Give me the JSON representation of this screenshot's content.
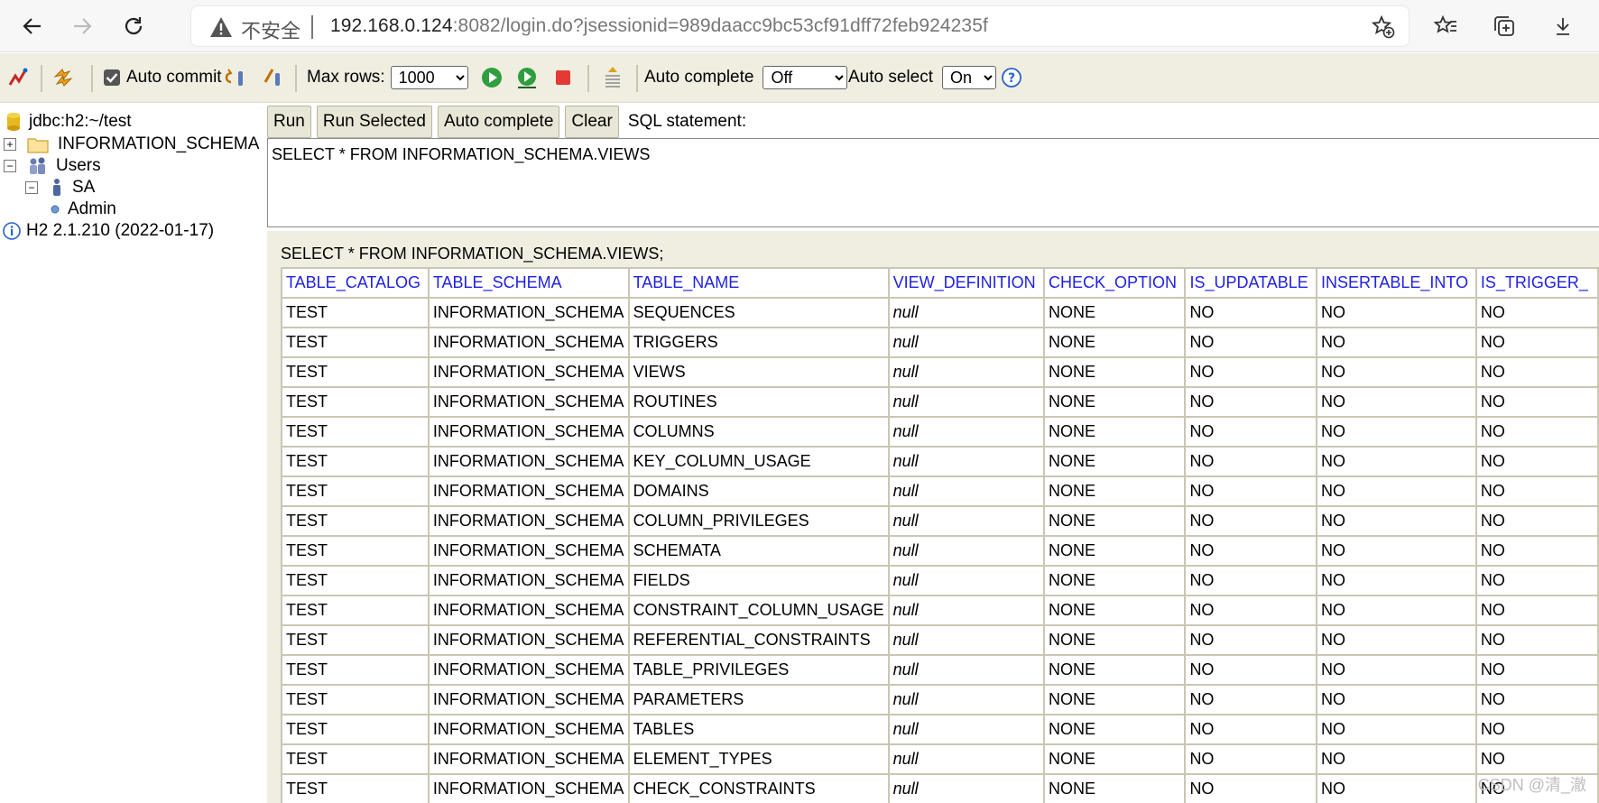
{
  "browser": {
    "security_label": "不安全",
    "url_host": "192.168.0.124",
    "url_rest": ":8082/login.do?jsessionid=989daacc9bc53cf91dff72feb924235f"
  },
  "toolbar": {
    "auto_commit_label": "Auto commit",
    "auto_commit_checked": true,
    "max_rows_label": "Max rows:",
    "max_rows_value": "1000",
    "auto_complete_label": "Auto complete",
    "auto_complete_value": "Off",
    "auto_select_label": "Auto select",
    "auto_select_value": "On",
    "help_glyph": "?"
  },
  "tree": {
    "connection": "jdbc:h2:~/test",
    "schema": "INFORMATION_SCHEMA",
    "users": "Users",
    "user": "SA",
    "role": "Admin",
    "version": "H2 2.1.210 (2022-01-17)",
    "expand_glyph": "+",
    "collapse_glyph": "−"
  },
  "query": {
    "buttons": [
      "Run",
      "Run Selected",
      "Auto complete",
      "Clear"
    ],
    "sql_label": "SQL statement:",
    "sql_text": "SELECT * FROM INFORMATION_SCHEMA.VIEWS"
  },
  "results": {
    "statement": "SELECT * FROM INFORMATION_SCHEMA.VIEWS;",
    "columns": [
      "TABLE_CATALOG",
      "TABLE_SCHEMA",
      "TABLE_NAME",
      "VIEW_DEFINITION",
      "CHECK_OPTION",
      "IS_UPDATABLE",
      "INSERTABLE_INTO",
      "IS_TRIGGER_"
    ],
    "rows": [
      [
        "TEST",
        "INFORMATION_SCHEMA",
        "SEQUENCES",
        "null",
        "NONE",
        "NO",
        "NO",
        "NO"
      ],
      [
        "TEST",
        "INFORMATION_SCHEMA",
        "TRIGGERS",
        "null",
        "NONE",
        "NO",
        "NO",
        "NO"
      ],
      [
        "TEST",
        "INFORMATION_SCHEMA",
        "VIEWS",
        "null",
        "NONE",
        "NO",
        "NO",
        "NO"
      ],
      [
        "TEST",
        "INFORMATION_SCHEMA",
        "ROUTINES",
        "null",
        "NONE",
        "NO",
        "NO",
        "NO"
      ],
      [
        "TEST",
        "INFORMATION_SCHEMA",
        "COLUMNS",
        "null",
        "NONE",
        "NO",
        "NO",
        "NO"
      ],
      [
        "TEST",
        "INFORMATION_SCHEMA",
        "KEY_COLUMN_USAGE",
        "null",
        "NONE",
        "NO",
        "NO",
        "NO"
      ],
      [
        "TEST",
        "INFORMATION_SCHEMA",
        "DOMAINS",
        "null",
        "NONE",
        "NO",
        "NO",
        "NO"
      ],
      [
        "TEST",
        "INFORMATION_SCHEMA",
        "COLUMN_PRIVILEGES",
        "null",
        "NONE",
        "NO",
        "NO",
        "NO"
      ],
      [
        "TEST",
        "INFORMATION_SCHEMA",
        "SCHEMATA",
        "null",
        "NONE",
        "NO",
        "NO",
        "NO"
      ],
      [
        "TEST",
        "INFORMATION_SCHEMA",
        "FIELDS",
        "null",
        "NONE",
        "NO",
        "NO",
        "NO"
      ],
      [
        "TEST",
        "INFORMATION_SCHEMA",
        "CONSTRAINT_COLUMN_USAGE",
        "null",
        "NONE",
        "NO",
        "NO",
        "NO"
      ],
      [
        "TEST",
        "INFORMATION_SCHEMA",
        "REFERENTIAL_CONSTRAINTS",
        "null",
        "NONE",
        "NO",
        "NO",
        "NO"
      ],
      [
        "TEST",
        "INFORMATION_SCHEMA",
        "TABLE_PRIVILEGES",
        "null",
        "NONE",
        "NO",
        "NO",
        "NO"
      ],
      [
        "TEST",
        "INFORMATION_SCHEMA",
        "PARAMETERS",
        "null",
        "NONE",
        "NO",
        "NO",
        "NO"
      ],
      [
        "TEST",
        "INFORMATION_SCHEMA",
        "TABLES",
        "null",
        "NONE",
        "NO",
        "NO",
        "NO"
      ],
      [
        "TEST",
        "INFORMATION_SCHEMA",
        "ELEMENT_TYPES",
        "null",
        "NONE",
        "NO",
        "NO",
        "NO"
      ],
      [
        "TEST",
        "INFORMATION_SCHEMA",
        "CHECK_CONSTRAINTS",
        "null",
        "NONE",
        "NO",
        "NO",
        "NO"
      ],
      [
        "",
        "",
        "",
        "",
        "",
        "",
        "",
        ""
      ]
    ]
  },
  "watermark": "CSDN @清_澈",
  "colors": {
    "toolbar_bg": "#efeee1",
    "header_link": "#1f1fe6",
    "grid": "#c9c7b4"
  }
}
